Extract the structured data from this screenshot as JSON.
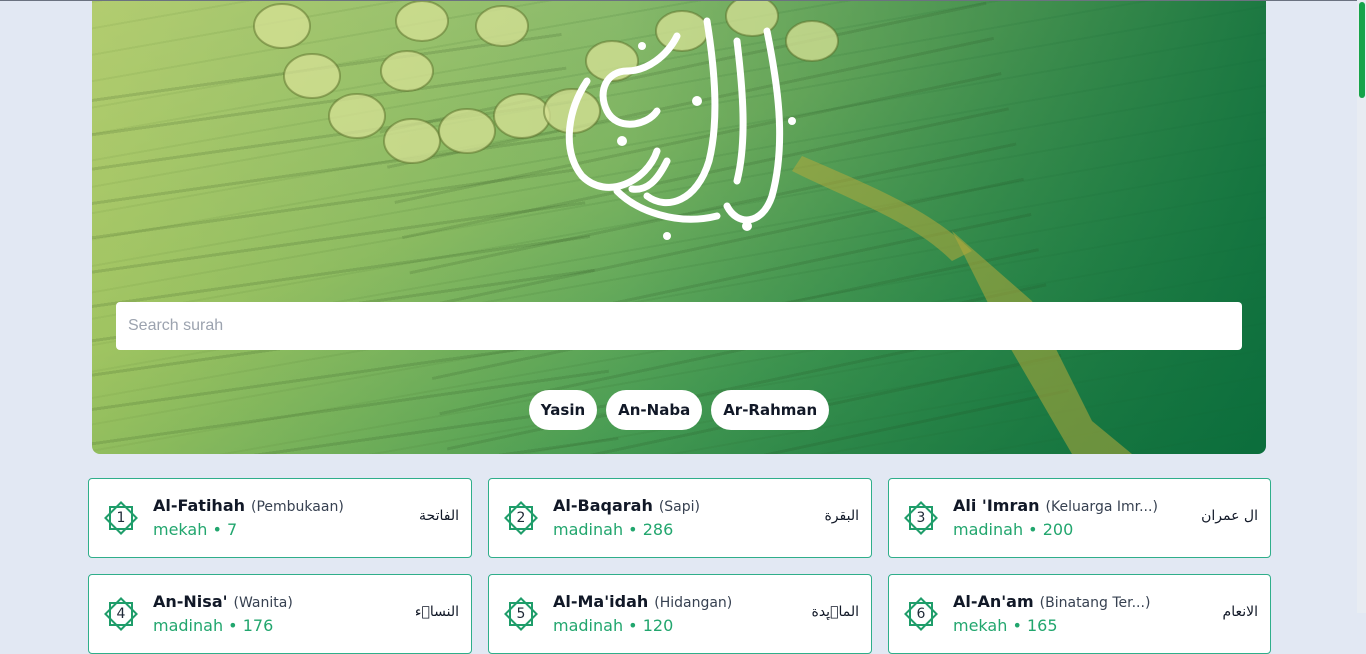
{
  "search": {
    "placeholder": "Search surah"
  },
  "quick_links": [
    "Yasin",
    "An-Naba",
    "Ar-Rahman"
  ],
  "colors": {
    "accent": "#22a66e",
    "card_border": "#2fae8a",
    "page_bg": "#e2e8f3"
  },
  "icons": {
    "hero_logo": "quran-calligraphy-logo",
    "surah_badge": "star-octagram-icon"
  },
  "surahs": [
    {
      "number": "1",
      "latin": "Al-Fatihah",
      "meaning": "(Pembukaan)",
      "place": "mekah",
      "verses": "7",
      "arabic": "الفاتحة"
    },
    {
      "number": "2",
      "latin": "Al-Baqarah",
      "meaning": "(Sapi)",
      "place": "madinah",
      "verses": "286",
      "arabic": "البقرة"
    },
    {
      "number": "3",
      "latin": "Ali 'Imran",
      "meaning": "(Keluarga Imr...)",
      "place": "madinah",
      "verses": "200",
      "arabic": "ال عمران"
    },
    {
      "number": "4",
      "latin": "An-Nisa'",
      "meaning": "(Wanita)",
      "place": "madinah",
      "verses": "176",
      "arabic": "النساۤء"
    },
    {
      "number": "5",
      "latin": "Al-Ma'idah",
      "meaning": "(Hidangan)",
      "place": "madinah",
      "verses": "120",
      "arabic": "الماۤىِٕدة"
    },
    {
      "number": "6",
      "latin": "Al-An'am",
      "meaning": "(Binatang Ter...)",
      "place": "mekah",
      "verses": "165",
      "arabic": "الانعام"
    }
  ]
}
